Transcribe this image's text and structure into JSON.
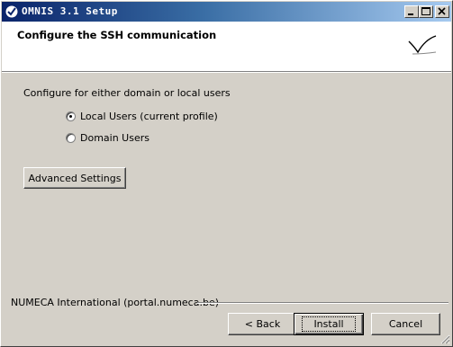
{
  "window": {
    "title": "OMNIS 3.1 Setup",
    "icons": {
      "app": "checkmark-circle-icon",
      "minimize": "minimize-icon",
      "maximize": "maximize-icon",
      "close": "close-icon"
    }
  },
  "header": {
    "title": "Configure the SSH communication",
    "logo": "checkmark-logo-icon"
  },
  "body": {
    "prompt": "Configure for either domain or local users",
    "options": [
      {
        "label": "Local Users (current profile)",
        "selected": true
      },
      {
        "label": "Domain Users",
        "selected": false
      }
    ],
    "advanced_button": "Advanced Settings"
  },
  "footer": {
    "brand": "NUMECA International (portal.numeca.be)",
    "back_button": "< Back",
    "install_button": "Install",
    "cancel_button": "Cancel"
  },
  "colors": {
    "titlebar_start": "#0a246a",
    "titlebar_end": "#a6caf0",
    "dialog_face": "#d4d0c8"
  }
}
